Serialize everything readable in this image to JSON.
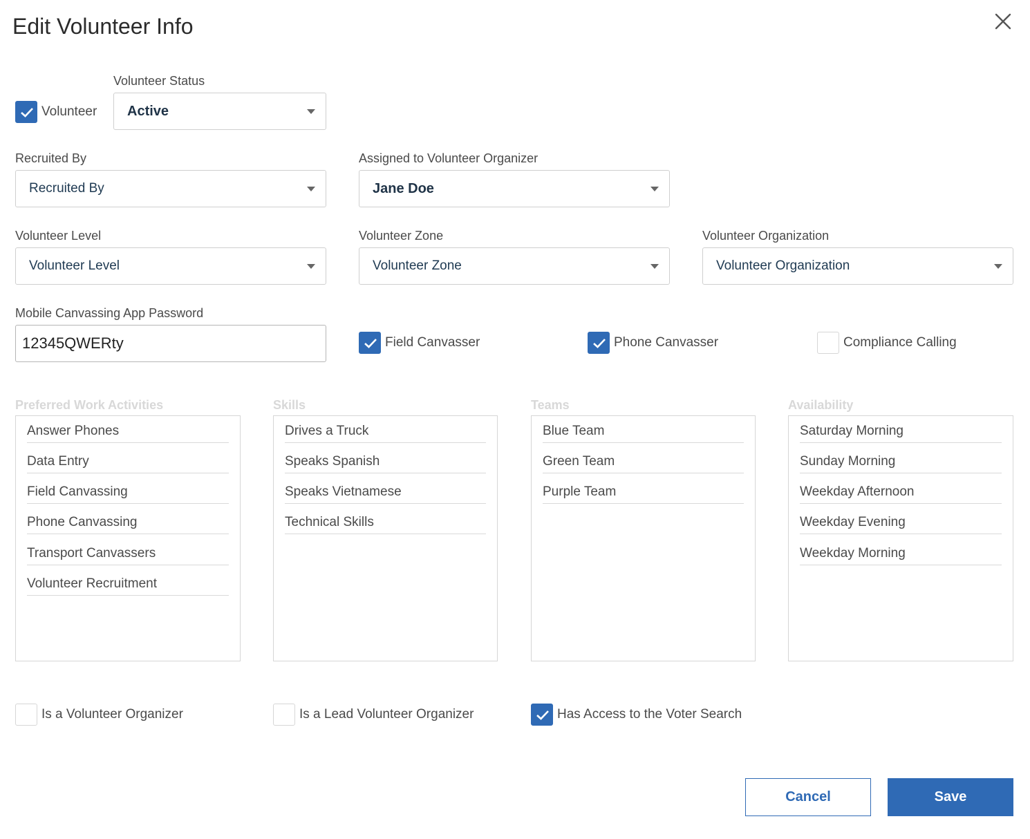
{
  "dialog": {
    "title": "Edit Volunteer Info"
  },
  "volunteer": {
    "label": "Volunteer",
    "checked": true
  },
  "status": {
    "label": "Volunteer Status",
    "value": "Active"
  },
  "recruited_by": {
    "label": "Recruited By",
    "value": "Recruited By"
  },
  "organizer": {
    "label": "Assigned to Volunteer Organizer",
    "value": "Jane Doe"
  },
  "level": {
    "label": "Volunteer Level",
    "value": "Volunteer Level"
  },
  "zone": {
    "label": "Volunteer Zone",
    "value": "Volunteer Zone"
  },
  "organization": {
    "label": "Volunteer Organization",
    "value": "Volunteer Organization"
  },
  "password": {
    "label": "Mobile Canvassing App Password",
    "value": "12345QWERty"
  },
  "roles": [
    {
      "label": "Field Canvasser",
      "checked": true
    },
    {
      "label": "Phone Canvasser",
      "checked": true
    },
    {
      "label": "Compliance Calling",
      "checked": false
    }
  ],
  "groups": {
    "activities": {
      "title": "Preferred Work Activities",
      "items": [
        "Answer Phones",
        "Data Entry",
        "Field Canvassing",
        "Phone Canvassing",
        "Transport Canvassers",
        "Volunteer Recruitment"
      ]
    },
    "skills": {
      "title": "Skills",
      "items": [
        "Drives a Truck",
        "Speaks Spanish",
        "Speaks Vietnamese",
        "Technical Skills"
      ]
    },
    "teams": {
      "title": "Teams",
      "items": [
        "Blue Team",
        "Green Team",
        "Purple Team"
      ]
    },
    "availability": {
      "title": "Availability",
      "items": [
        "Saturday Morning",
        "Sunday Morning",
        "Weekday Afternoon",
        "Weekday Evening",
        "Weekday Morning"
      ]
    }
  },
  "flags": [
    {
      "label": "Is a Volunteer Organizer",
      "checked": false
    },
    {
      "label": "Is a Lead Volunteer Organizer",
      "checked": false
    },
    {
      "label": "Has Access to the Voter Search",
      "checked": true
    }
  ],
  "actions": {
    "cancel": "Cancel",
    "save": "Save"
  },
  "colors": {
    "accent": "#2f6ab5",
    "section_heading": "#d8d8d8",
    "border": "#cfcfcf"
  }
}
